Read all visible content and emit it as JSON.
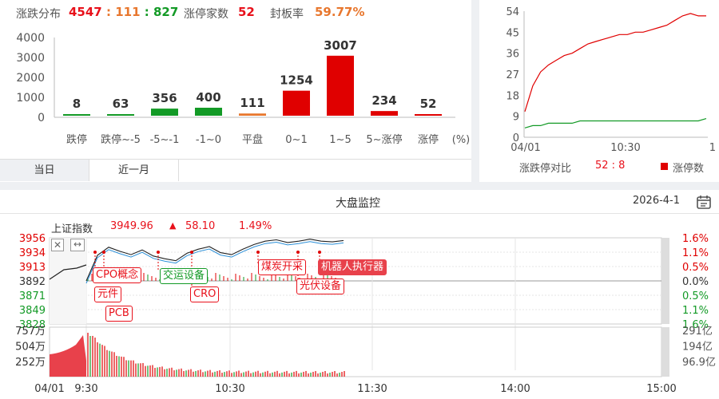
{
  "distribution": {
    "title": "涨跌分布",
    "up_down": {
      "up": "4547",
      "sep1": " : ",
      "flat": "111",
      "sep2": " : ",
      "down": "827"
    },
    "limit_label": "涨停家数",
    "limit_count": "52",
    "seal_label": "封板率",
    "seal_rate": "59.77%",
    "tabs": [
      "当日",
      "近一月"
    ],
    "unit": "(%)"
  },
  "chart_data": [
    {
      "type": "bar",
      "title": "",
      "categories": [
        "跌停",
        "跌停~-5",
        "-5~-1",
        "-1~0",
        "平盘",
        "0~1",
        "1~5",
        "5~涨停",
        "涨停"
      ],
      "values": [
        8,
        63,
        356,
        400,
        111,
        1254,
        3007,
        234,
        52
      ],
      "value_labels": [
        "8",
        "63",
        "356",
        "400",
        "111",
        "1254",
        "3007",
        "234",
        "52"
      ],
      "colors": [
        "#139a26",
        "#139a26",
        "#139a26",
        "#139a26",
        "#e8772e",
        "#e00000",
        "#e00000",
        "#e00000",
        "#e00000"
      ],
      "ylim": [
        0,
        4000
      ],
      "yticks": [
        "4000",
        "3000",
        "2000",
        "1000",
        "0"
      ]
    },
    {
      "type": "line",
      "title": "",
      "xlabel": "",
      "ylabel": "",
      "xticks": [
        "04/01",
        "10:30",
        "1"
      ],
      "yticks": [
        "54",
        "45",
        "36",
        "27",
        "18",
        "9",
        "0"
      ],
      "ylim": [
        0,
        54
      ],
      "series": [
        {
          "name": "涨停数",
          "color": "#e00000",
          "values": [
            11,
            22,
            28,
            31,
            33,
            35,
            36,
            38,
            40,
            41,
            42,
            43,
            44,
            44,
            45,
            45,
            46,
            47,
            48,
            50,
            52,
            53,
            52,
            52
          ]
        },
        {
          "values": [
            4,
            5,
            5,
            6,
            6,
            6,
            6,
            7,
            7,
            7,
            7,
            7,
            7,
            7,
            7,
            7,
            7,
            7,
            7,
            7,
            7,
            7,
            7,
            8
          ]
        }
      ],
      "ratio_label": "涨跌停对比",
      "ratio_value": "52 : 8",
      "legend_label": "涨停数"
    },
    {
      "type": "line",
      "title": "",
      "index_name": "上证指数",
      "price": "3949.96",
      "change": "58.10",
      "change_pct": "1.49%",
      "left_ticks": [
        "3956",
        "3934",
        "3913",
        "3892",
        "3871",
        "3849",
        "3828"
      ],
      "right_ticks": [
        "1.6%",
        "1.1%",
        "0.5%",
        "0.0%",
        "0.5%",
        "1.1%",
        "1.6%"
      ],
      "series": [
        {
          "values": [
            3892,
            3930,
            3942,
            3936,
            3931,
            3938,
            3929,
            3925,
            3922,
            3933,
            3939,
            3943,
            3934,
            3931,
            3939,
            3946,
            3951,
            3953,
            3949,
            3951,
            3954,
            3951,
            3950,
            3952
          ]
        }
      ]
    },
    {
      "type": "bar",
      "title": "",
      "left_ticks": [
        "757万",
        "504万",
        "252万"
      ],
      "right_ticks": [
        "291亿",
        "194亿",
        "96.9亿"
      ],
      "xticks": [
        "04/01",
        "9:30",
        "10:30",
        "11:30",
        "14:00",
        "15:00"
      ]
    }
  ],
  "monitor": {
    "title": "大盘监控",
    "date": "2026-4-1",
    "tags": [
      "CPO概念",
      "元件",
      "PCB",
      "交运设备",
      "CRO",
      "煤炭开采",
      "光伏设备",
      "机器人执行器"
    ]
  }
}
